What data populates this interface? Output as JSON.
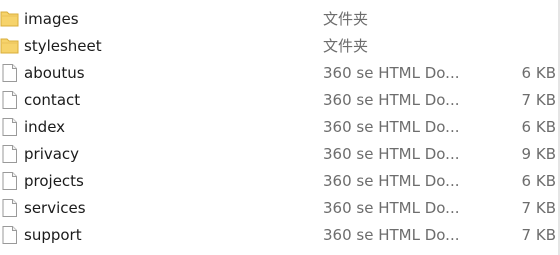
{
  "files": [
    {
      "icon": "folder-icon",
      "name": "images",
      "type": "文件夹",
      "size": ""
    },
    {
      "icon": "folder-icon",
      "name": "stylesheet",
      "type": "文件夹",
      "size": ""
    },
    {
      "icon": "html-file-icon",
      "name": "aboutus",
      "type": "360 se HTML Do...",
      "size": "6 KB"
    },
    {
      "icon": "html-file-icon",
      "name": "contact",
      "type": "360 se HTML Do...",
      "size": "7 KB"
    },
    {
      "icon": "html-file-icon",
      "name": "index",
      "type": "360 se HTML Do...",
      "size": "6 KB"
    },
    {
      "icon": "html-file-icon",
      "name": "privacy",
      "type": "360 se HTML Do...",
      "size": "9 KB"
    },
    {
      "icon": "html-file-icon",
      "name": "projects",
      "type": "360 se HTML Do...",
      "size": "6 KB"
    },
    {
      "icon": "html-file-icon",
      "name": "services",
      "type": "360 se HTML Do...",
      "size": "7 KB"
    },
    {
      "icon": "html-file-icon",
      "name": "support",
      "type": "360 se HTML Do...",
      "size": "7 KB"
    }
  ],
  "colors": {
    "folder_yellow": "#f6d36b",
    "folder_yellow_dark": "#d8ad3a",
    "file_outline": "#9a9a9a",
    "secondary_text": "#6d6d6d"
  }
}
